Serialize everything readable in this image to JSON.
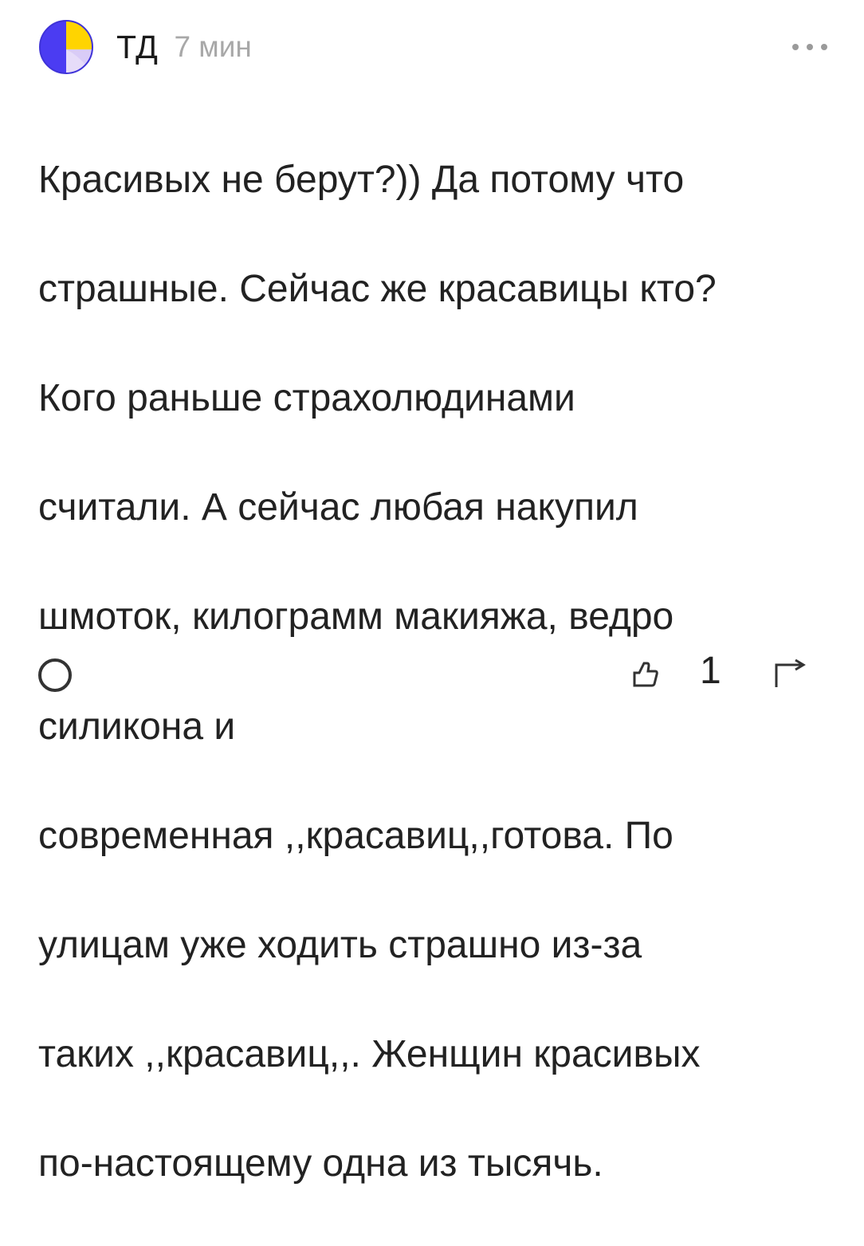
{
  "comment": {
    "author": "ТД",
    "time": "7 мин",
    "text_lines": [
      "Красивых не берут?)) Да потому что",
      "страшные. Сейчас же красавицы кто?",
      "Кого раньше страхолюдинами",
      "считали. А сейчас любая накупил",
      "шмоток, килограмм макияжа, ведро",
      "силикона и",
      "современная ,,красавиц,,готова. По",
      "улицам уже ходить страшно из-за",
      "таких ,,красавиц,,. Женщин красивых",
      "по-настоящему одна из тысячь."
    ],
    "like_count": "1",
    "icons": {
      "avatar": "avatar",
      "more": "more-dots-icon",
      "reply": "reply-icon",
      "like": "thumbs-up-icon",
      "share": "share-icon"
    },
    "colors": {
      "avatar_blue": "#4B3CF2",
      "avatar_yellow": "#FFD400",
      "avatar_lavender": "#D9CCF7",
      "meta_gray": "#A8A8A8"
    }
  }
}
